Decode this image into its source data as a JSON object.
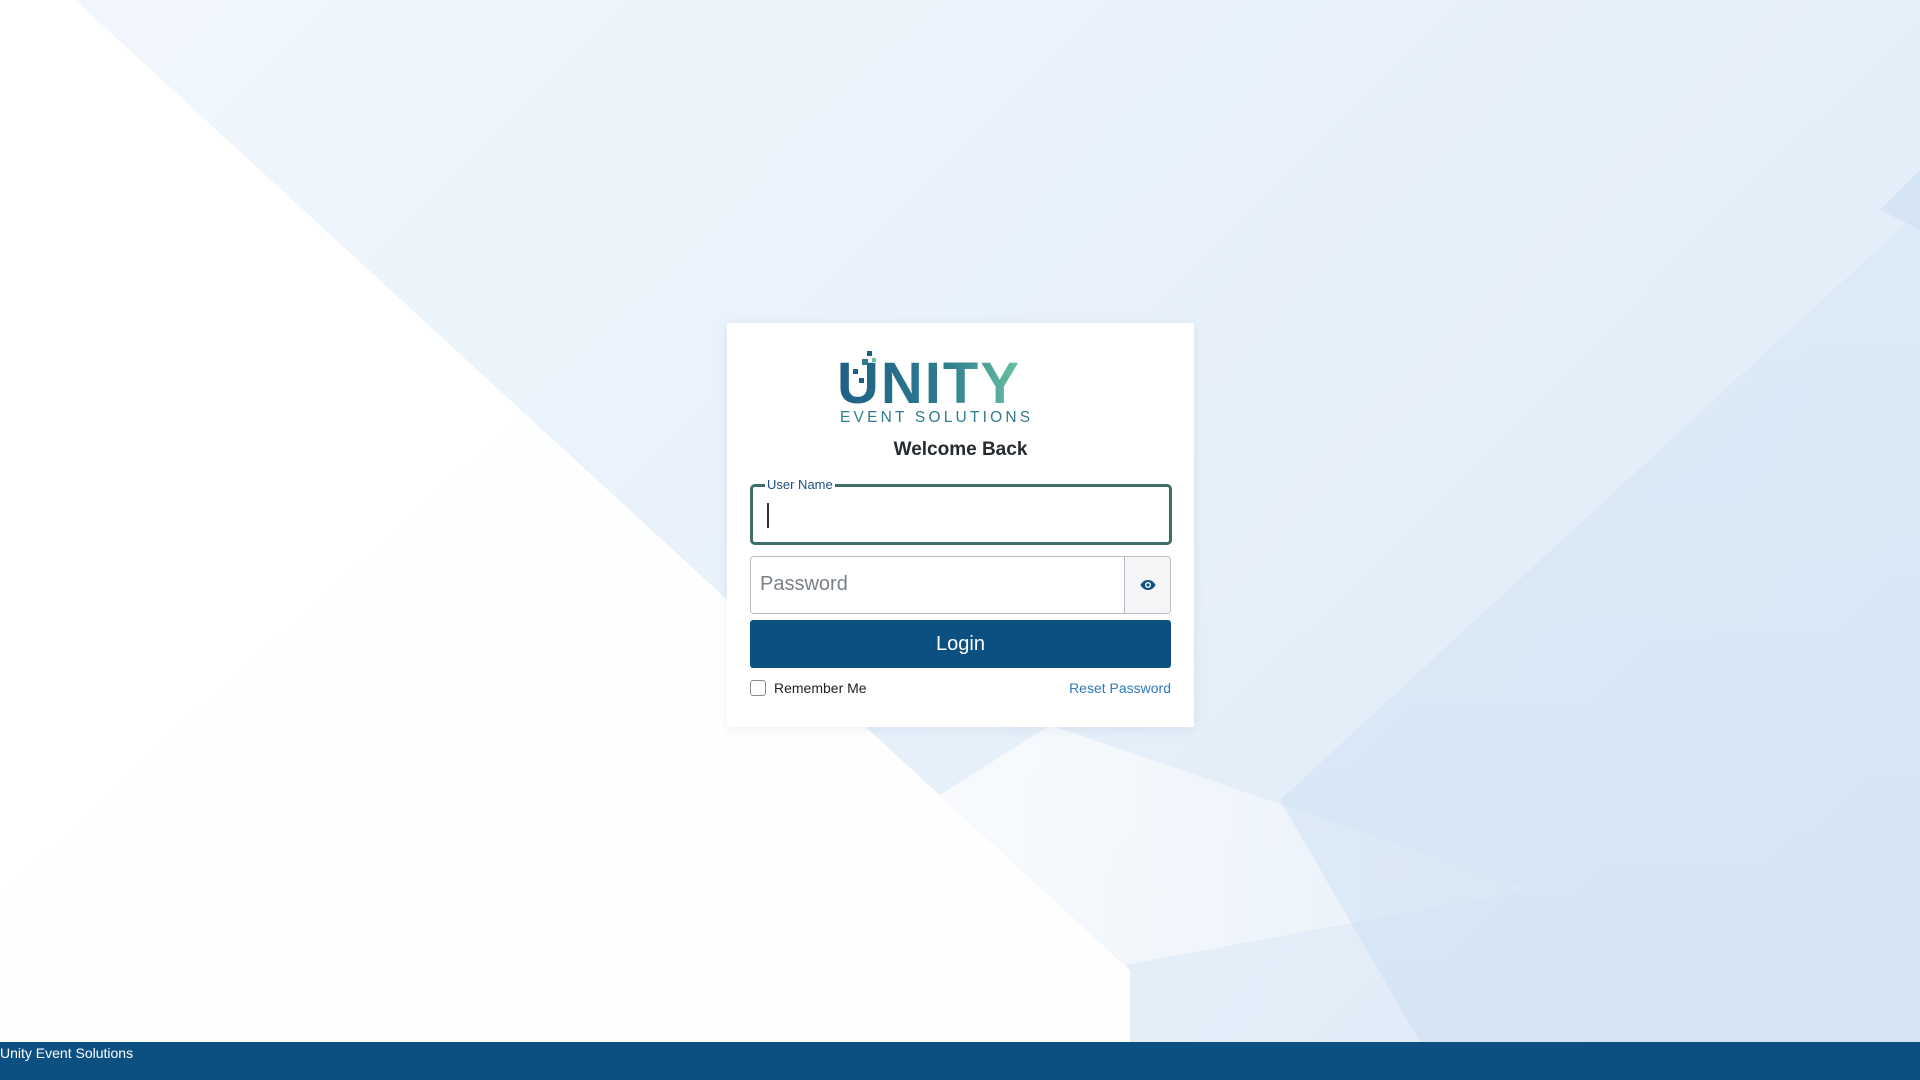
{
  "brand": {
    "logo_word": "UNITY",
    "logo_tagline": "EVENT SOLUTIONS",
    "colors": {
      "primary": "#0b5081",
      "logo_teal": "#2f7c8e",
      "logo_green": "#6cc3a4",
      "link": "#2f7bbf"
    }
  },
  "login": {
    "welcome": "Welcome Back",
    "username_label": "User Name",
    "username_value": "",
    "password_placeholder": "Password",
    "password_value": "",
    "show_password_icon": "eye-icon",
    "login_label": "Login",
    "remember_label": "Remember Me",
    "remember_checked": false,
    "reset_label": "Reset Password"
  },
  "footer": {
    "text": "Unity Event Solutions"
  }
}
